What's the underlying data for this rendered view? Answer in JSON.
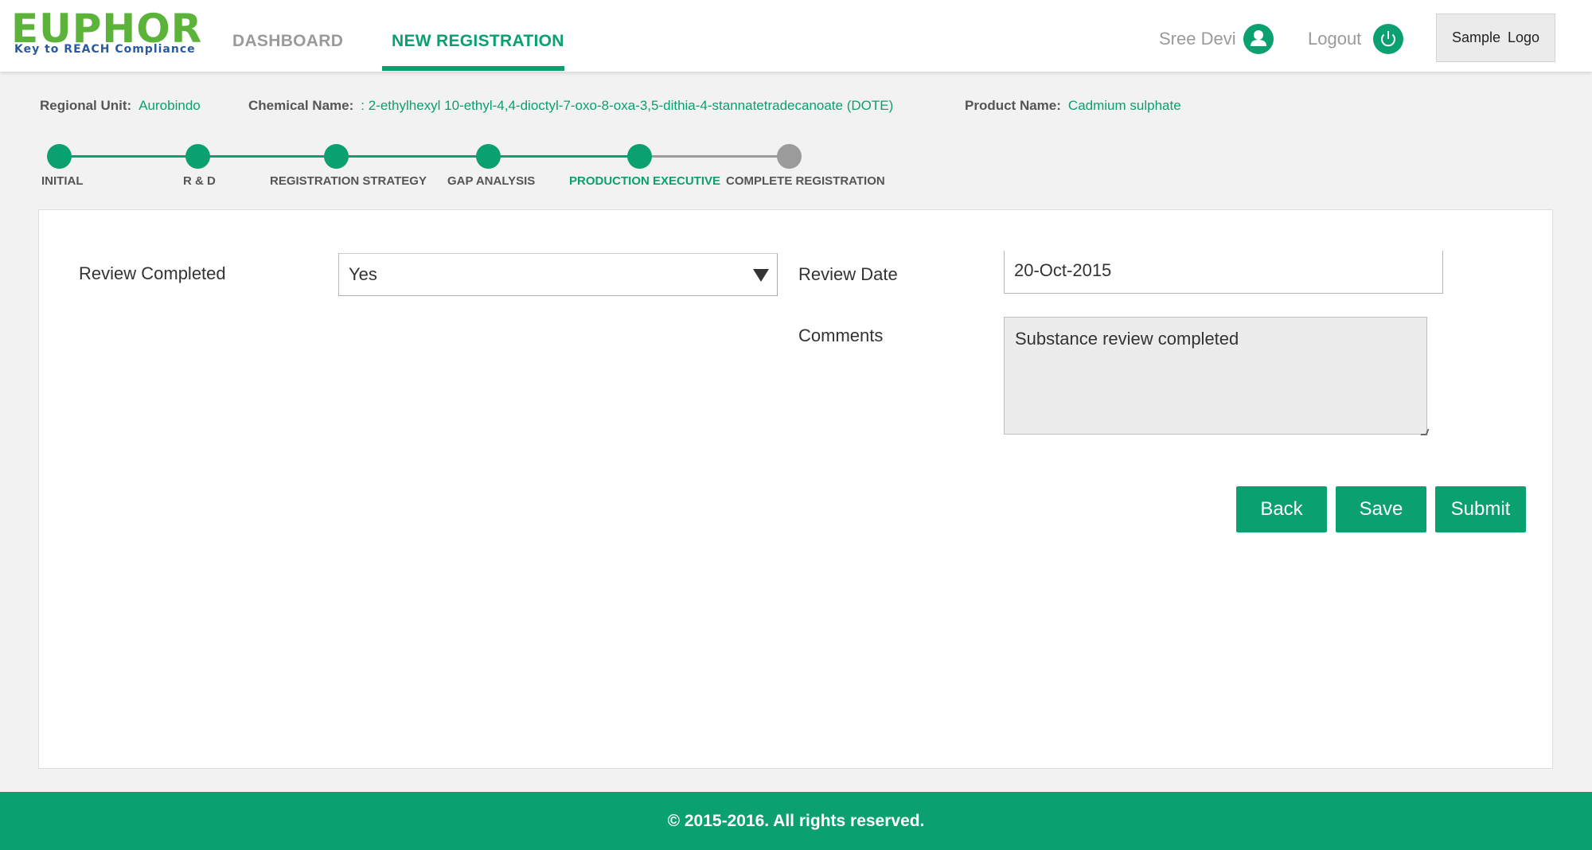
{
  "header": {
    "logo_text": "EUPHOR",
    "logo_tagline": "Key to REACH Compliance",
    "nav": [
      {
        "label": "DASHBOARD"
      },
      {
        "label": "NEW REGISTRATION"
      }
    ],
    "user_name": "Sree Devi",
    "user_icon": "user-icon",
    "logout_label": "Logout",
    "logout_icon": "power-icon",
    "sample_logo": "Sample Logo"
  },
  "info": {
    "regional_unit_label": "Regional Unit:",
    "regional_unit_value": "Aurobindo",
    "chemical_name_label": "Chemical Name:",
    "chemical_name_value": ": 2-ethylhexyl 10-ethyl-4,4-dioctyl-7-oxo-8-oxa-3,5-dithia-4-stannatetradecanoate (DOTE)",
    "product_name_label": "Product Name:",
    "product_name_value": "Cadmium sulphate"
  },
  "stepper": {
    "steps": [
      {
        "label": "INITIAL",
        "state": "done"
      },
      {
        "label": "R & D",
        "state": "done"
      },
      {
        "label": "REGISTRATION STRATEGY",
        "state": "done"
      },
      {
        "label": "GAP ANALYSIS",
        "state": "done"
      },
      {
        "label": "PRODUCTION EXECUTIVE",
        "state": "current"
      },
      {
        "label": "COMPLETE REGISTRATION",
        "state": "pending"
      }
    ]
  },
  "form": {
    "review_completed_label": "Review Completed",
    "review_completed_value": "Yes",
    "review_date_label": "Review Date",
    "review_date_value": "20-Oct-2015",
    "comments_label": "Comments",
    "comments_value": "Substance review completed",
    "buttons": {
      "back": "Back",
      "save": "Save",
      "submit": "Submit"
    }
  },
  "footer": {
    "copyright": "© 2015-2016. All rights reserved."
  },
  "colors": {
    "accent": "#0aa070",
    "logo_green": "#5cb33a",
    "logo_blue": "#2a5a9e",
    "inactive": "#9b9b9b"
  }
}
